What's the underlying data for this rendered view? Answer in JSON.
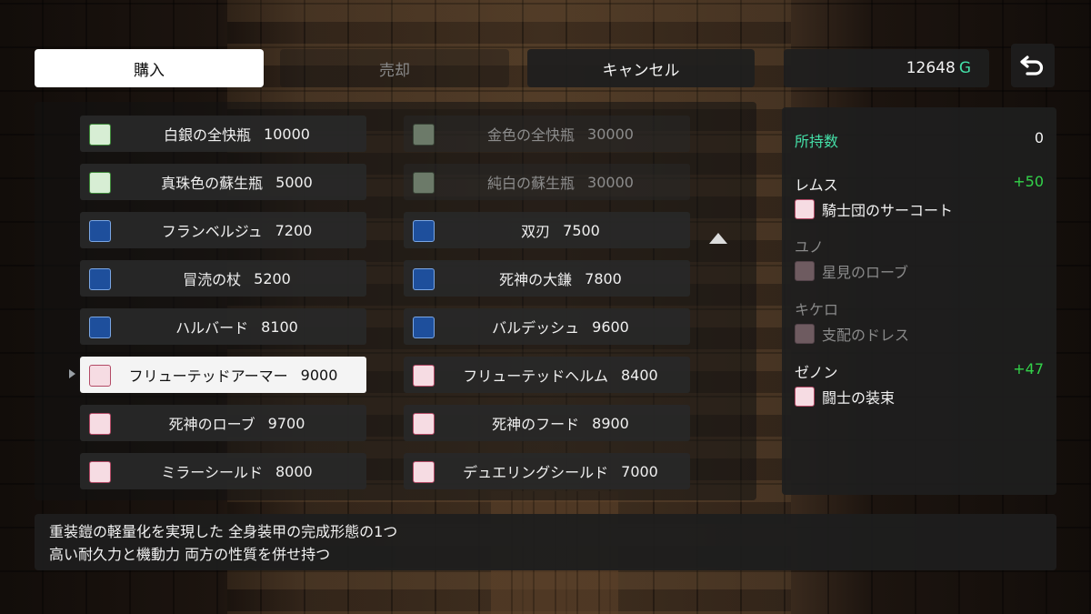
{
  "tabs": {
    "buy": "購入",
    "sell": "売却",
    "cancel": "キャンセル"
  },
  "gold": {
    "amount": "12648",
    "unit": "G"
  },
  "back_icon": "return-arrow-icon",
  "items": [
    {
      "name": "白銀の全快瓶",
      "price": "10000",
      "icon": "potion-icon",
      "enabled": true
    },
    {
      "name": "金色の全快瓶",
      "price": "30000",
      "icon": "potion-icon",
      "enabled": false
    },
    {
      "name": "真珠色の蘇生瓶",
      "price": "5000",
      "icon": "potion-icon",
      "enabled": true
    },
    {
      "name": "純白の蘇生瓶",
      "price": "30000",
      "icon": "potion-icon",
      "enabled": false
    },
    {
      "name": "フランベルジュ",
      "price": "7200",
      "icon": "sword-icon",
      "enabled": true
    },
    {
      "name": "双刃",
      "price": "7500",
      "icon": "twin-blade-icon",
      "enabled": true
    },
    {
      "name": "冒涜の杖",
      "price": "5200",
      "icon": "staff-icon",
      "enabled": true
    },
    {
      "name": "死神の大鎌",
      "price": "7800",
      "icon": "scythe-icon",
      "enabled": true
    },
    {
      "name": "ハルバード",
      "price": "8100",
      "icon": "halberd-icon",
      "enabled": true
    },
    {
      "name": "バルデッシュ",
      "price": "9600",
      "icon": "axe-icon",
      "enabled": true
    },
    {
      "name": "フリューテッドアーマー",
      "price": "9000",
      "icon": "armor-icon",
      "enabled": true,
      "selected": true
    },
    {
      "name": "フリューテッドヘルム",
      "price": "8400",
      "icon": "helmet-icon",
      "enabled": true
    },
    {
      "name": "死神のローブ",
      "price": "9700",
      "icon": "robe-icon",
      "enabled": true
    },
    {
      "name": "死神のフード",
      "price": "8900",
      "icon": "hood-icon",
      "enabled": true
    },
    {
      "name": "ミラーシールド",
      "price": "8000",
      "icon": "shield-icon",
      "enabled": true
    },
    {
      "name": "デュエリングシールド",
      "price": "7000",
      "icon": "shield-icon",
      "enabled": true
    }
  ],
  "party": {
    "owned_label": "所持数",
    "owned_value": "0",
    "members": [
      {
        "name": "レムス",
        "delta": "+50",
        "equip": "騎士団のサーコート",
        "dim": false
      },
      {
        "name": "ユノ",
        "delta": "",
        "equip": "星見のローブ",
        "dim": true
      },
      {
        "name": "キケロ",
        "delta": "",
        "equip": "支配のドレス",
        "dim": true
      },
      {
        "name": "ゼノン",
        "delta": "+47",
        "equip": "闘士の装束",
        "dim": false
      }
    ]
  },
  "description": {
    "line1": "重装鎧の軽量化を実現した 全身装甲の完成形態の1つ",
    "line2": "高い耐久力と機動力 両方の性質を併せ持つ"
  },
  "colors": {
    "accent_teal": "#44e0a8",
    "stat_green": "#33d34a",
    "panel_bg": "#1e1e1e",
    "selected_bg": "#f4f4f4"
  }
}
